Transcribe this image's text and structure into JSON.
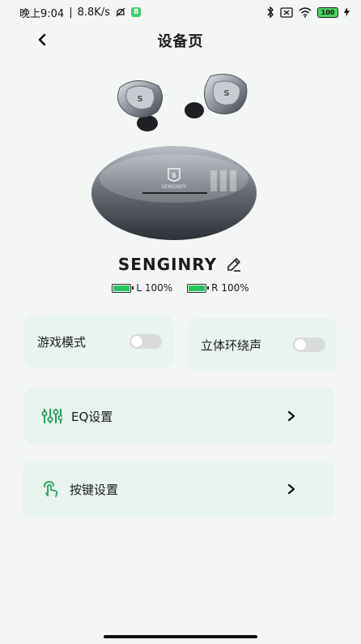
{
  "status_bar": {
    "time": "晚上9:04",
    "network_speed": "8.8K/s",
    "badge": "8",
    "battery": "100"
  },
  "header": {
    "title": "设备页",
    "back_icon": "chevron-left-icon"
  },
  "device": {
    "name": "SENGINRY",
    "case_brand": "SENGINRY",
    "left_label": "L 100%",
    "right_label": "R 100%",
    "left_level": 1.0,
    "right_level": 1.0
  },
  "toggles": [
    {
      "label": "游戏模式",
      "on": false
    },
    {
      "label": "立体环绕声",
      "on": false
    }
  ],
  "settings": [
    {
      "label": "EQ设置",
      "icon": "equalizer-icon"
    },
    {
      "label": "按键设置",
      "icon": "touch-gesture-icon"
    }
  ],
  "colors": {
    "accent": "#22c55e",
    "card_bg": "#e9f4ee",
    "page_bg": "#f4f6f5"
  }
}
